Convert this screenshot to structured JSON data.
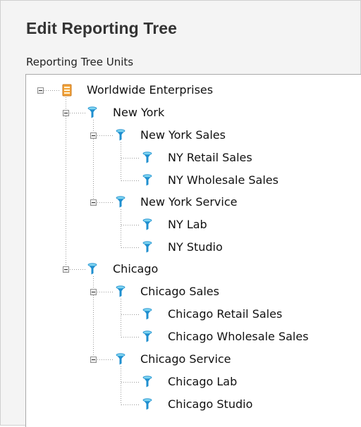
{
  "dialog": {
    "title": "Edit Reporting Tree",
    "section_label": "Reporting Tree Units"
  },
  "tree": {
    "root": {
      "label": "Worldwide Enterprises",
      "icon": "building-icon",
      "expanded": true
    },
    "nodes": [
      {
        "label": "New York",
        "icon": "funnel-icon",
        "expanded": true
      },
      {
        "label": "New York Sales",
        "icon": "funnel-icon",
        "expanded": true
      },
      {
        "label": "NY Retail Sales",
        "icon": "funnel-icon"
      },
      {
        "label": "NY Wholesale Sales",
        "icon": "funnel-icon"
      },
      {
        "label": "New York Service",
        "icon": "funnel-icon",
        "expanded": true
      },
      {
        "label": "NY Lab",
        "icon": "funnel-icon"
      },
      {
        "label": "NY Studio",
        "icon": "funnel-icon"
      },
      {
        "label": "Chicago",
        "icon": "funnel-icon",
        "expanded": true
      },
      {
        "label": "Chicago Sales",
        "icon": "funnel-icon",
        "expanded": true
      },
      {
        "label": "Chicago Retail Sales",
        "icon": "funnel-icon"
      },
      {
        "label": "Chicago Wholesale Sales",
        "icon": "funnel-icon"
      },
      {
        "label": "Chicago Service",
        "icon": "funnel-icon",
        "expanded": true
      },
      {
        "label": "Chicago Lab",
        "icon": "funnel-icon"
      },
      {
        "label": "Chicago Studio",
        "icon": "funnel-icon"
      }
    ]
  },
  "colors": {
    "funnel_top": "#7fd4f0",
    "funnel_stem": "#1f8fcf",
    "building": "#f3a33a",
    "connector": "#9a9a9a"
  }
}
